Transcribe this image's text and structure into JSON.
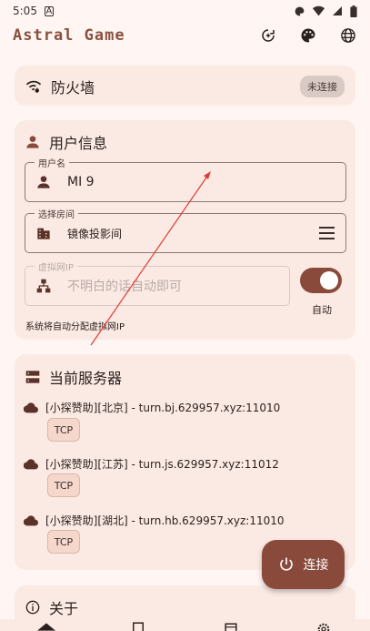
{
  "status_bar": {
    "time": "5:05",
    "notif_glyph": "A"
  },
  "app_bar": {
    "title": "Astral Game"
  },
  "firewall": {
    "title": "防火墙",
    "status": "未连接"
  },
  "user_info": {
    "title": "用户信息",
    "username": {
      "label": "用户名",
      "value": "MI 9"
    },
    "room": {
      "label": "选择房间",
      "value": "镜像投影间"
    },
    "virtual_ip": {
      "label": "虚拟网IP",
      "placeholder": "不明白的话自动即可"
    },
    "auto_toggle": {
      "label": "自动",
      "on": true
    },
    "hint": "系统将自动分配虚拟网IP"
  },
  "servers": {
    "title": "当前服务器",
    "items": [
      {
        "name": "[小探赞助][北京] - turn.bj.629957.xyz:11010",
        "protocol": "TCP"
      },
      {
        "name": "[小探赞助][江苏] - turn.js.629957.xyz:11012",
        "protocol": "TCP"
      },
      {
        "name": "[小探赞助][湖北] - turn.hb.629957.xyz:11010",
        "protocol": "TCP"
      }
    ]
  },
  "fab": {
    "label": "连接"
  },
  "about": {
    "title": "关于"
  },
  "colors": {
    "accent": "#8a4a3b",
    "card": "#fbeae4",
    "background": "#fff6f3",
    "title": "#8a5140"
  }
}
